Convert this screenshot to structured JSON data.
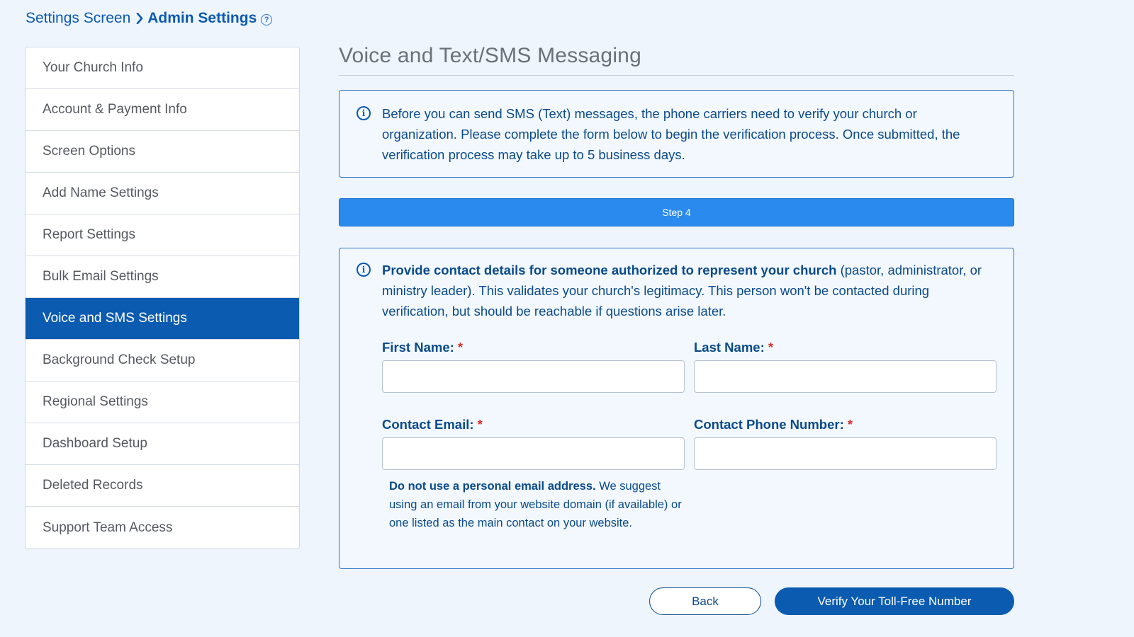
{
  "breadcrumb": {
    "parent": "Settings Screen",
    "current": "Admin Settings",
    "help_icon": "question-circle-icon"
  },
  "sidebar": {
    "items": [
      {
        "label": "Your Church Info",
        "active": false
      },
      {
        "label": "Account & Payment Info",
        "active": false
      },
      {
        "label": "Screen Options",
        "active": false
      },
      {
        "label": "Add Name Settings",
        "active": false
      },
      {
        "label": "Report Settings",
        "active": false
      },
      {
        "label": "Bulk Email Settings",
        "active": false
      },
      {
        "label": "Voice and SMS Settings",
        "active": true
      },
      {
        "label": "Background Check Setup",
        "active": false
      },
      {
        "label": "Regional Settings",
        "active": false
      },
      {
        "label": "Dashboard Setup",
        "active": false
      },
      {
        "label": "Deleted Records",
        "active": false
      },
      {
        "label": "Support Team Access",
        "active": false
      }
    ]
  },
  "main": {
    "title": "Voice and Text/SMS Messaging",
    "info_text": "Before you can send SMS (Text) messages, the phone carriers need to verify your church or organization. Please complete the form below to begin the verification process. Once submitted, the verification process may take up to 5 business days.",
    "step_label": "Step 4",
    "form": {
      "intro_bold": "Provide contact details for someone authorized to represent your church",
      "intro_rest": " (pastor, administrator, or ministry leader). This validates your church's legitimacy. This person won't be contacted during verification, but should be reachable if questions arise later.",
      "first_name_label": "First Name:",
      "last_name_label": "Last Name:",
      "email_label": "Contact Email:",
      "phone_label": "Contact Phone Number:",
      "required_mark": "*",
      "first_name_value": "",
      "last_name_value": "",
      "email_value": "",
      "phone_value": "",
      "note_bold": "Do not use a personal email address.",
      "note_rest": " We suggest using an email from your website domain (if available) or one listed as the main contact on your website."
    }
  },
  "actions": {
    "back_label": "Back",
    "verify_label": "Verify Your Toll-Free Number"
  },
  "colors": {
    "accent": "#0b5bb0",
    "step_bar": "#2b8aee",
    "required": "#d0342c",
    "background": "#eef5fc"
  }
}
